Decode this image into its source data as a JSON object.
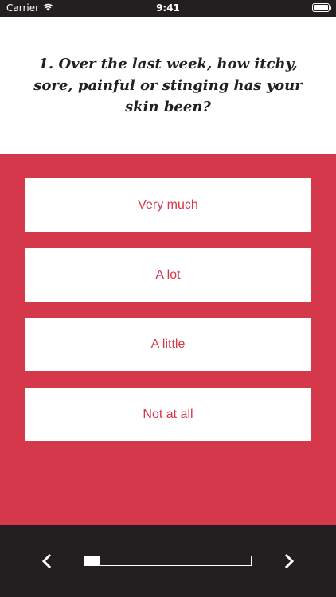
{
  "status_bar": {
    "carrier": "Carrier",
    "time": "9:41",
    "icons": [
      "wifi-icon",
      "battery-icon"
    ]
  },
  "question": {
    "text": "1. Over the last week, how itchy, sore, painful or stinging has your skin been?"
  },
  "answers": [
    {
      "label": "Very much"
    },
    {
      "label": "A lot"
    },
    {
      "label": "A little"
    },
    {
      "label": "Not at all"
    }
  ],
  "navigation": {
    "prev_icon": "chevron-left-icon",
    "next_icon": "chevron-right-icon",
    "progress_fraction": 0.09
  },
  "colors": {
    "accent": "#d6384b",
    "dark": "#231f20",
    "surface": "#ffffff"
  }
}
